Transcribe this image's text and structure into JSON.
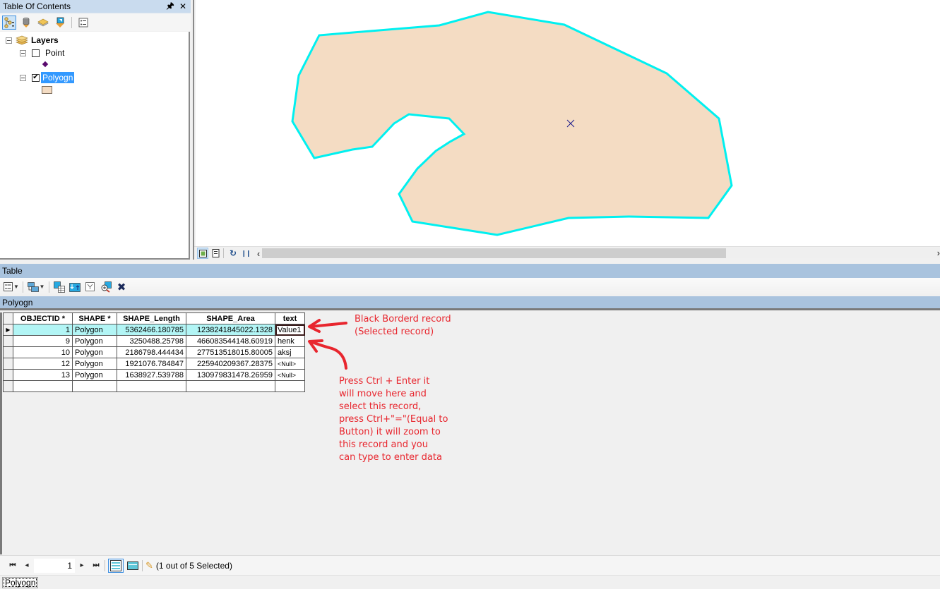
{
  "toc": {
    "title": "Table Of Contents",
    "pin_icon": "pin-icon",
    "close_icon": "close-icon",
    "toolbar": [
      {
        "name": "list-by-drawing-order",
        "icon": "drawing-order-icon",
        "active": true
      },
      {
        "name": "list-by-source",
        "icon": "database-icon",
        "active": false
      },
      {
        "name": "list-by-visibility",
        "icon": "layers-visibility-icon",
        "active": false
      },
      {
        "name": "list-by-selection",
        "icon": "selection-icon",
        "active": false
      },
      {
        "name": "options",
        "icon": "options-icon",
        "active": false
      }
    ],
    "tree": {
      "root_label": "Layers",
      "layers": [
        {
          "label": "Point",
          "checked": false,
          "selected": false,
          "symbol": "point",
          "symbol_color": "#5a0a6e"
        },
        {
          "label": "Polyogn",
          "checked": true,
          "selected": true,
          "symbol": "polygon",
          "symbol_color": "#f4dcc3"
        }
      ]
    }
  },
  "map": {
    "polygon_fill": "#f4dcc3",
    "polygon_outline": "#00f0f0",
    "centroid_marker": "x",
    "centroid_color": "#1a1a8c"
  },
  "map_bottom": {
    "layout_view_icon": "data-view-icon",
    "page_view_icon": "layout-view-icon",
    "refresh_icon": "refresh-icon",
    "pause_icon": "pause-icon",
    "scroll_left_icon": "chevron-left-icon",
    "scroll_right_icon": "chevron-right-icon",
    "scroll_position": 0.65
  },
  "table": {
    "title": "Table",
    "toolbar": [
      {
        "name": "table-options",
        "icon": "table-options-icon",
        "dropdown": true
      },
      {
        "name": "related-tables",
        "icon": "related-tables-icon",
        "dropdown": true
      },
      {
        "name": "select-by-attributes",
        "icon": "select-by-attributes-icon"
      },
      {
        "name": "switch-selection",
        "icon": "switch-selection-icon"
      },
      {
        "name": "clear-selection",
        "icon": "clear-selection-icon"
      },
      {
        "name": "zoom-to-selected",
        "icon": "zoom-to-selected-icon"
      },
      {
        "name": "delete-selected",
        "icon": "delete-icon"
      }
    ],
    "tab_label": "Polyogn",
    "columns": [
      "OBJECTID *",
      "SHAPE *",
      "SHAPE_Length",
      "SHAPE_Area",
      "text"
    ],
    "rows": [
      {
        "oid": "1",
        "shape": "Polygon",
        "length": "5362466.180785",
        "area": "1238241845022.1328",
        "text": "Value1",
        "selected": true,
        "current": true
      },
      {
        "oid": "9",
        "shape": "Polygon",
        "length": "3250488.25798",
        "area": "466083544148.60919",
        "text": "henk",
        "selected": false,
        "current": false
      },
      {
        "oid": "10",
        "shape": "Polygon",
        "length": "2186798.444434",
        "area": "277513518015.80005",
        "text": "aksj",
        "selected": false,
        "current": false
      },
      {
        "oid": "12",
        "shape": "Polygon",
        "length": "1921076.784847",
        "area": "225940209367.28375",
        "text": "<Null>",
        "selected": false,
        "current": false
      },
      {
        "oid": "13",
        "shape": "Polygon",
        "length": "1638927.539788",
        "area": "130979831478.26959",
        "text": "<Null>",
        "selected": false,
        "current": false
      }
    ],
    "status": {
      "record_number": "1",
      "selected_text": "(1 out of 5 Selected)",
      "first_icon": "first-record-icon",
      "prev_icon": "previous-record-icon",
      "next_icon": "next-record-icon",
      "last_icon": "last-record-icon",
      "show_all_icon": "show-all-records-icon",
      "show_selected_icon": "show-selected-records-icon",
      "edit_icon": "pencil-icon"
    },
    "bottom_tab": "Polyogn"
  },
  "annotations": {
    "color": "#e8262e",
    "note1": [
      "Black Borderd record",
      "(Selected record)"
    ],
    "note2": [
      "Press Ctrl + Enter it",
      "will move here and",
      "select this record,",
      "press Ctrl+\"=\"(Equal to",
      "Button) it will zoom to",
      "this record and you",
      "can type to enter data"
    ]
  }
}
